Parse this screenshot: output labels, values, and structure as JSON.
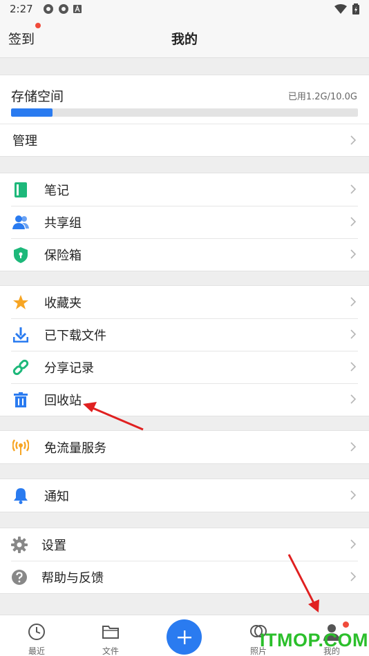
{
  "status_bar": {
    "time": "2:27"
  },
  "top_bar": {
    "left_label": "签到",
    "title": "我的"
  },
  "storage": {
    "label": "存储空间",
    "used_text": "已用1.2G/10.0G",
    "used_fraction": 0.12,
    "manage_label": "管理"
  },
  "groups": [
    {
      "items": [
        {
          "label": "笔记",
          "icon": "notebook-icon",
          "color": "#1db87a"
        },
        {
          "label": "共享组",
          "icon": "group-icon",
          "color": "#2a7bf0"
        },
        {
          "label": "保险箱",
          "icon": "shield-icon",
          "color": "#1db87a"
        }
      ]
    },
    {
      "items": [
        {
          "label": "收藏夹",
          "icon": "star-icon",
          "color": "#f7a523"
        },
        {
          "label": "已下载文件",
          "icon": "download-icon",
          "color": "#2a7bf0"
        },
        {
          "label": "分享记录",
          "icon": "link-icon",
          "color": "#1db87a"
        },
        {
          "label": "回收站",
          "icon": "trash-icon",
          "color": "#2a7bf0"
        }
      ]
    },
    {
      "items": [
        {
          "label": "免流量服务",
          "icon": "signal-icon",
          "color": "#f7a523"
        }
      ]
    },
    {
      "items": [
        {
          "label": "通知",
          "icon": "bell-icon",
          "color": "#2a7bf0"
        }
      ]
    },
    {
      "items": [
        {
          "label": "设置",
          "icon": "gear-icon",
          "color": "#888888"
        },
        {
          "label": "帮助与反馈",
          "icon": "help-icon",
          "color": "#888888"
        }
      ]
    }
  ],
  "bottom_nav": [
    {
      "label": "最近",
      "icon": "clock-icon"
    },
    {
      "label": "文件",
      "icon": "folder-icon"
    },
    {
      "label": "照片",
      "icon": "photo-icon"
    },
    {
      "label": "我的",
      "icon": "person-icon"
    }
  ],
  "watermark": "ITMOP.COM",
  "colors": {
    "accent": "#2a7bf0",
    "badge": "#f04b3b",
    "arrow": "#e02020"
  }
}
